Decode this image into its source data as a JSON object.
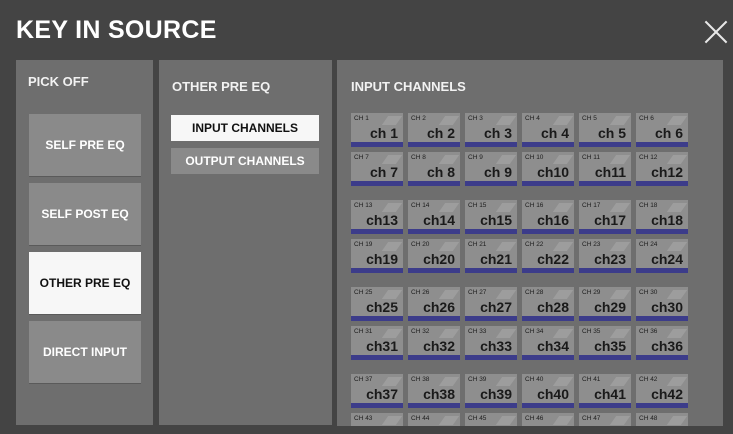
{
  "window": {
    "title": "KEY IN SOURCE"
  },
  "pick_off": {
    "heading": "PICK OFF",
    "buttons": [
      {
        "label": "SELF PRE EQ",
        "active": false
      },
      {
        "label": "SELF POST EQ",
        "active": false
      },
      {
        "label": "OTHER PRE EQ",
        "active": true
      },
      {
        "label": "DIRECT INPUT",
        "active": false
      }
    ]
  },
  "other_pre_eq": {
    "heading": "OTHER PRE EQ",
    "buttons": [
      {
        "label": "INPUT CHANNELS",
        "active": true
      },
      {
        "label": "OUTPUT CHANNELS",
        "active": false
      }
    ]
  },
  "input_channels": {
    "heading": "INPUT CHANNELS",
    "colors": {
      "assign_bar": "#3c3c8a",
      "button": "#8e8e8e"
    },
    "channels": [
      {
        "small": "CH 1",
        "name": "ch 1"
      },
      {
        "small": "CH 2",
        "name": "ch 2"
      },
      {
        "small": "CH 3",
        "name": "ch 3"
      },
      {
        "small": "CH 4",
        "name": "ch 4"
      },
      {
        "small": "CH 5",
        "name": "ch 5"
      },
      {
        "small": "CH 6",
        "name": "ch 6"
      },
      {
        "small": "CH 7",
        "name": "ch 7"
      },
      {
        "small": "CH 8",
        "name": "ch 8"
      },
      {
        "small": "CH 9",
        "name": "ch 9"
      },
      {
        "small": "CH 10",
        "name": "ch10"
      },
      {
        "small": "CH 11",
        "name": "ch11"
      },
      {
        "small": "CH 12",
        "name": "ch12"
      },
      {
        "small": "CH 13",
        "name": "ch13"
      },
      {
        "small": "CH 14",
        "name": "ch14"
      },
      {
        "small": "CH 15",
        "name": "ch15"
      },
      {
        "small": "CH 16",
        "name": "ch16"
      },
      {
        "small": "CH 17",
        "name": "ch17"
      },
      {
        "small": "CH 18",
        "name": "ch18"
      },
      {
        "small": "CH 19",
        "name": "ch19"
      },
      {
        "small": "CH 20",
        "name": "ch20"
      },
      {
        "small": "CH 21",
        "name": "ch21"
      },
      {
        "small": "CH 22",
        "name": "ch22"
      },
      {
        "small": "CH 23",
        "name": "ch23"
      },
      {
        "small": "CH 24",
        "name": "ch24"
      },
      {
        "small": "CH 25",
        "name": "ch25"
      },
      {
        "small": "CH 26",
        "name": "ch26"
      },
      {
        "small": "CH 27",
        "name": "ch27"
      },
      {
        "small": "CH 28",
        "name": "ch28"
      },
      {
        "small": "CH 29",
        "name": "ch29"
      },
      {
        "small": "CH 30",
        "name": "ch30"
      },
      {
        "small": "CH 31",
        "name": "ch31"
      },
      {
        "small": "CH 32",
        "name": "ch32"
      },
      {
        "small": "CH 33",
        "name": "ch33"
      },
      {
        "small": "CH 34",
        "name": "ch34"
      },
      {
        "small": "CH 35",
        "name": "ch35"
      },
      {
        "small": "CH 36",
        "name": "ch36"
      },
      {
        "small": "CH 37",
        "name": "ch37"
      },
      {
        "small": "CH 38",
        "name": "ch38"
      },
      {
        "small": "CH 39",
        "name": "ch39"
      },
      {
        "small": "CH 40",
        "name": "ch40"
      },
      {
        "small": "CH 41",
        "name": "ch41"
      },
      {
        "small": "CH 42",
        "name": "ch42"
      },
      {
        "small": "CH 43",
        "name": ""
      },
      {
        "small": "CH 44",
        "name": ""
      },
      {
        "small": "CH 45",
        "name": ""
      },
      {
        "small": "CH 46",
        "name": ""
      },
      {
        "small": "CH 47",
        "name": ""
      },
      {
        "small": "CH 48",
        "name": ""
      }
    ]
  }
}
